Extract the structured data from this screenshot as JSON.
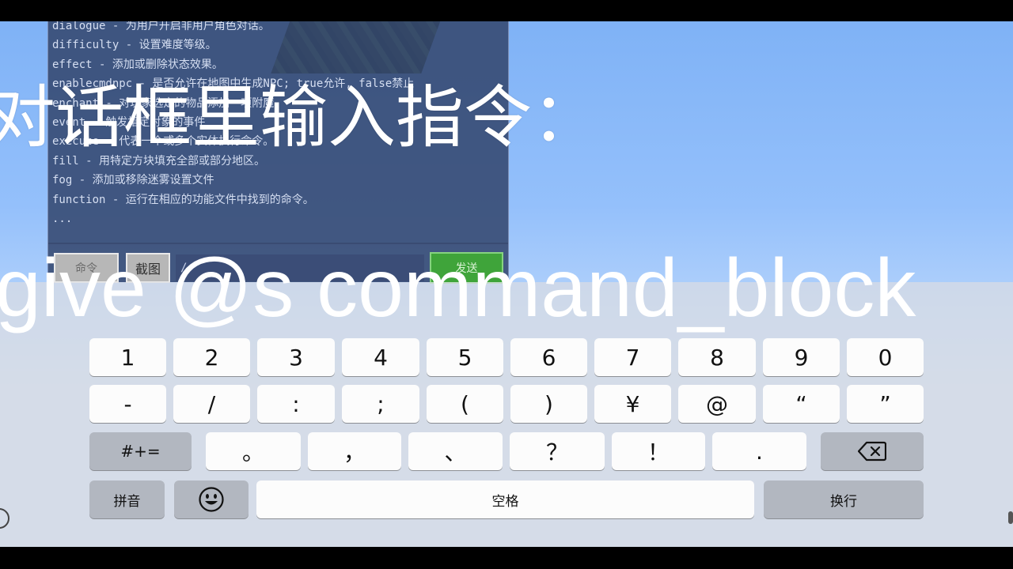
{
  "chat": {
    "lines": [
      "dialogue - 为用户开启非用户角色对话。",
      "difficulty - 设置难度等级。",
      "effect - 添加或删除状态效果。",
      "enablecmdnpc - 是否允许在地图中生成NPC; true允许, false禁止",
      "enchant - 对玩家选定的物品添加一项附魔",
      "event - 触发指定对象的事件",
      "execute - 代表一个或多个实体执行命令。",
      "fill - 用特定方块填充全部或部分地区。",
      "fog - 添加或移除迷雾设置文件",
      "function - 运行在相应的功能文件中找到的命令。",
      "..."
    ],
    "command_button": "命令",
    "screenshot_button": "截图",
    "input_value": "/",
    "send_button": "发送"
  },
  "overlay": {
    "heading": "对话框里输入指令：",
    "command": "give @s command_block"
  },
  "keyboard": {
    "row1": [
      "1",
      "2",
      "3",
      "4",
      "5",
      "6",
      "7",
      "8",
      "9",
      "0"
    ],
    "row2": [
      "-",
      "/",
      ":",
      ";",
      "(",
      ")",
      "¥",
      "@",
      "“",
      "”"
    ],
    "row3": {
      "shift": "#+=",
      "keys": [
        "。",
        "，",
        "、",
        "？",
        "！",
        "."
      ],
      "backspace_icon": "backspace-icon"
    },
    "row4": {
      "pinyin": "拼音",
      "emoji_icon": "emoji-icon",
      "space": "空格",
      "return": "换行"
    }
  }
}
